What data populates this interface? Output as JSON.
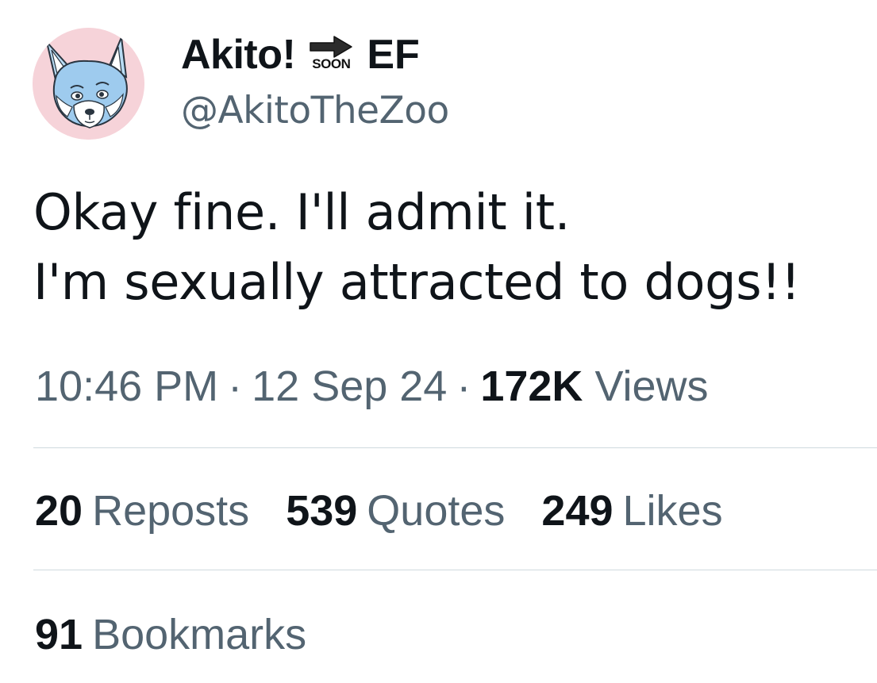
{
  "author": {
    "display_name": "Akito!",
    "badge_text": "SOON",
    "name_suffix": "EF",
    "handle": "@AkitoTheZoo",
    "avatar_icon": "wolf-avatar-icon"
  },
  "tweet": {
    "lines": [
      "Okay fine. I'll admit it.",
      "I'm sexually attracted to dogs!!"
    ]
  },
  "meta": {
    "time": "10:46 PM",
    "separator": "·",
    "date": "12 Sep 24",
    "views_count": "172K",
    "views_label": "Views"
  },
  "stats": {
    "reposts_count": "20",
    "reposts_label": "Reposts",
    "quotes_count": "539",
    "quotes_label": "Quotes",
    "likes_count": "249",
    "likes_label": "Likes",
    "bookmarks_count": "91",
    "bookmarks_label": "Bookmarks"
  },
  "colors": {
    "text_primary": "#0f1419",
    "text_secondary": "#536471",
    "divider": "#cfd9de",
    "avatar_bg": "#f6d3d9",
    "wolf_fur": "#9ecbee"
  }
}
